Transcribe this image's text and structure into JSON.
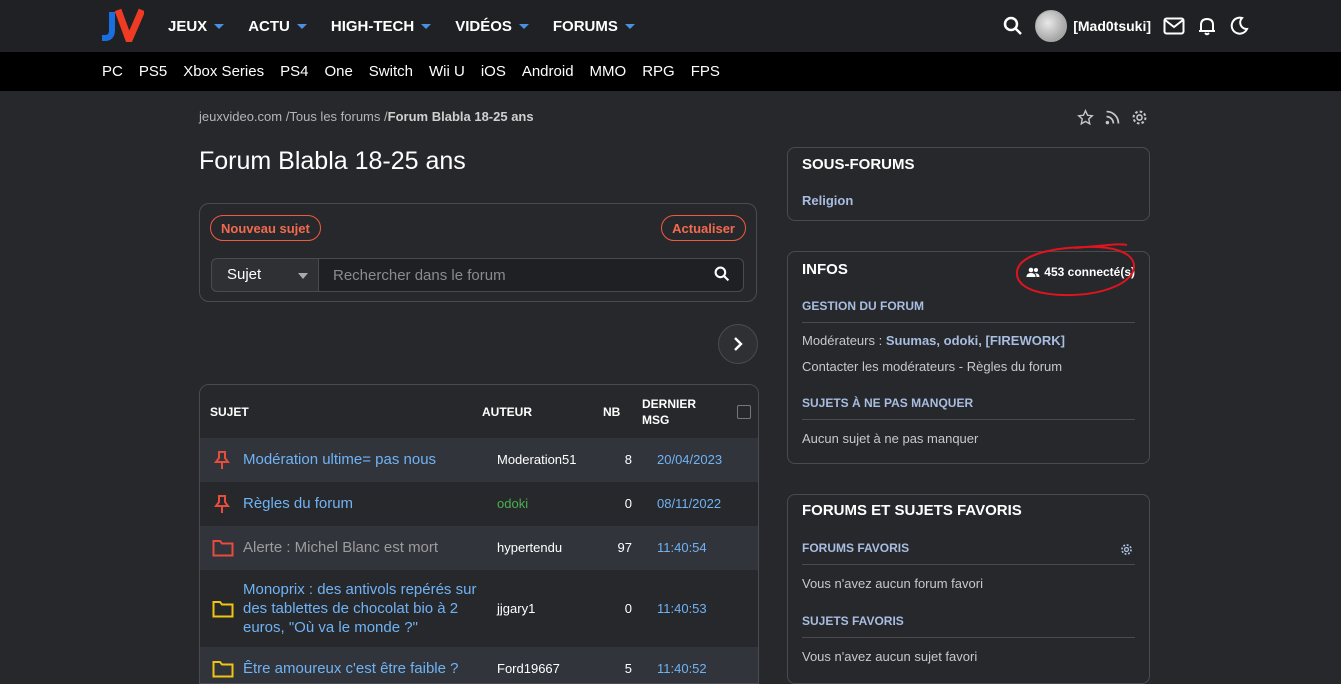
{
  "header": {
    "nav": [
      {
        "label": "JEUX"
      },
      {
        "label": "ACTU"
      },
      {
        "label": "HIGH-TECH"
      },
      {
        "label": "VIDÉOS"
      },
      {
        "label": "FORUMS"
      }
    ],
    "username": "[Mad0tsuki]"
  },
  "platforms": [
    "PC",
    "PS5",
    "Xbox Series",
    "PS4",
    "One",
    "Switch",
    "Wii U",
    "iOS",
    "Android",
    "MMO",
    "RPG",
    "FPS"
  ],
  "breadcrumb": {
    "site": "jeuxvideo.com",
    "sep": "/",
    "all": "Tous les forums",
    "current": "Forum Blabla 18-25 ans"
  },
  "page_title": "Forum Blabla 18-25 ans",
  "toolbar": {
    "new_topic": "Nouveau sujet",
    "refresh": "Actualiser",
    "search_type": "Sujet",
    "search_placeholder": "Rechercher dans le forum"
  },
  "table": {
    "headers": {
      "subject": "SUJET",
      "author": "AUTEUR",
      "nb": "NB",
      "last_line1": "DERNIER",
      "last_line2": "MSG"
    },
    "rows": [
      {
        "subject": "Modération ultime= pas nous",
        "author": "Moderation51",
        "nb": "8",
        "last": "20/04/2023",
        "type": "pin",
        "author_color": "#ffffff"
      },
      {
        "subject": "Règles du forum",
        "author": "odoki",
        "nb": "0",
        "last": "08/11/2022",
        "type": "pin",
        "author_color": "#4caf50"
      },
      {
        "subject": "Alerte : Michel Blanc est mort",
        "author": "hypertendu",
        "nb": "97",
        "last": "11:40:54",
        "type": "folder-red",
        "author_color": "#ffffff"
      },
      {
        "subject": "Monoprix : des antivols repérés sur des tablettes de chocolat bio à 2 euros, \"Où va le monde ?\"",
        "author": "jjgary1",
        "nb": "0",
        "last": "11:40:53",
        "type": "folder-yellow",
        "author_color": "#ffffff"
      },
      {
        "subject": "Être amoureux c'est être faible ?",
        "author": "Ford19667",
        "nb": "5",
        "last": "11:40:52",
        "type": "folder-yellow",
        "author_color": "#ffffff"
      }
    ]
  },
  "sidebar": {
    "subforums": {
      "title": "SOUS-FORUMS",
      "items": [
        "Religion"
      ]
    },
    "infos": {
      "title": "INFOS",
      "connected": "453 connecté(s)",
      "gestion_title": "GESTION DU FORUM",
      "mods_label": "Modérateurs : ",
      "mods": "Suumas, odoki, [FIREWORK]",
      "contact": "Contacter les modérateurs - Règles du forum",
      "must_title": "SUJETS À NE PAS MANQUER",
      "must_empty": "Aucun sujet à ne pas manquer"
    },
    "favorites": {
      "title": "FORUMS ET SUJETS FAVORIS",
      "forums_title": "FORUMS FAVORIS",
      "forums_empty": "Vous n'avez aucun forum favori",
      "topics_title": "SUJETS FAVORIS",
      "topics_empty": "Vous n'avez aucun sujet favori"
    }
  },
  "colors": {
    "accent_orange": "#f05a3c",
    "link_blue": "#6fb3f4",
    "annotation_red": "#e0141e"
  }
}
